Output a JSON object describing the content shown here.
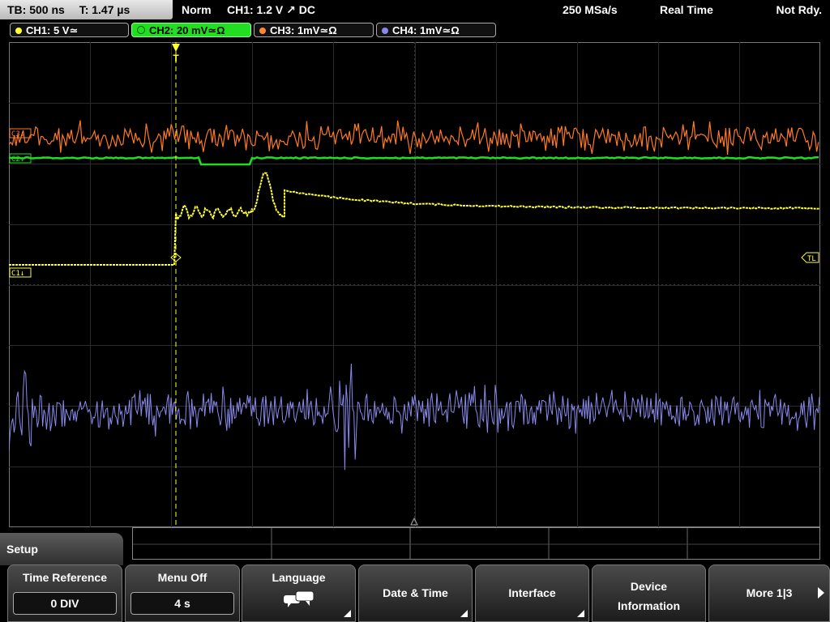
{
  "topbar": {
    "timebase": "TB: 500 ns",
    "trigger_time": "T: 1.47 µs",
    "mode": "Norm",
    "trigger": "CH1: 1.2 V ↗ DC",
    "sample_rate": "250 MSa/s",
    "acq_mode": "Real Time",
    "status": "Not Rdy."
  },
  "channels": [
    {
      "label": "CH1: 5 V≃",
      "color": "#ffff33"
    },
    {
      "label": "CH2: 20 mV≃Ω",
      "color": "#22dd22"
    },
    {
      "label": "CH3: 1mV≃Ω",
      "color": "#ff8833"
    },
    {
      "label": "CH4: 1mV≃Ω",
      "color": "#8888ee"
    }
  ],
  "markers": {
    "ch3": "C3↓",
    "ch2": "C2↓",
    "ch1": "C1↓",
    "trigger_level": "TL",
    "trigger_pos": "T"
  },
  "setup_label": "Setup",
  "softkeys": {
    "time_reference": {
      "label": "Time Reference",
      "value": "0 DIV"
    },
    "menu_off": {
      "label": "Menu Off",
      "value": "4 s"
    },
    "language": {
      "label": "Language"
    },
    "date_time": {
      "label": "Date & Time"
    },
    "interface": {
      "label": "Interface"
    },
    "device_information": {
      "label1": "Device",
      "label2": "Information"
    },
    "more": {
      "label": "More 1|3"
    }
  }
}
